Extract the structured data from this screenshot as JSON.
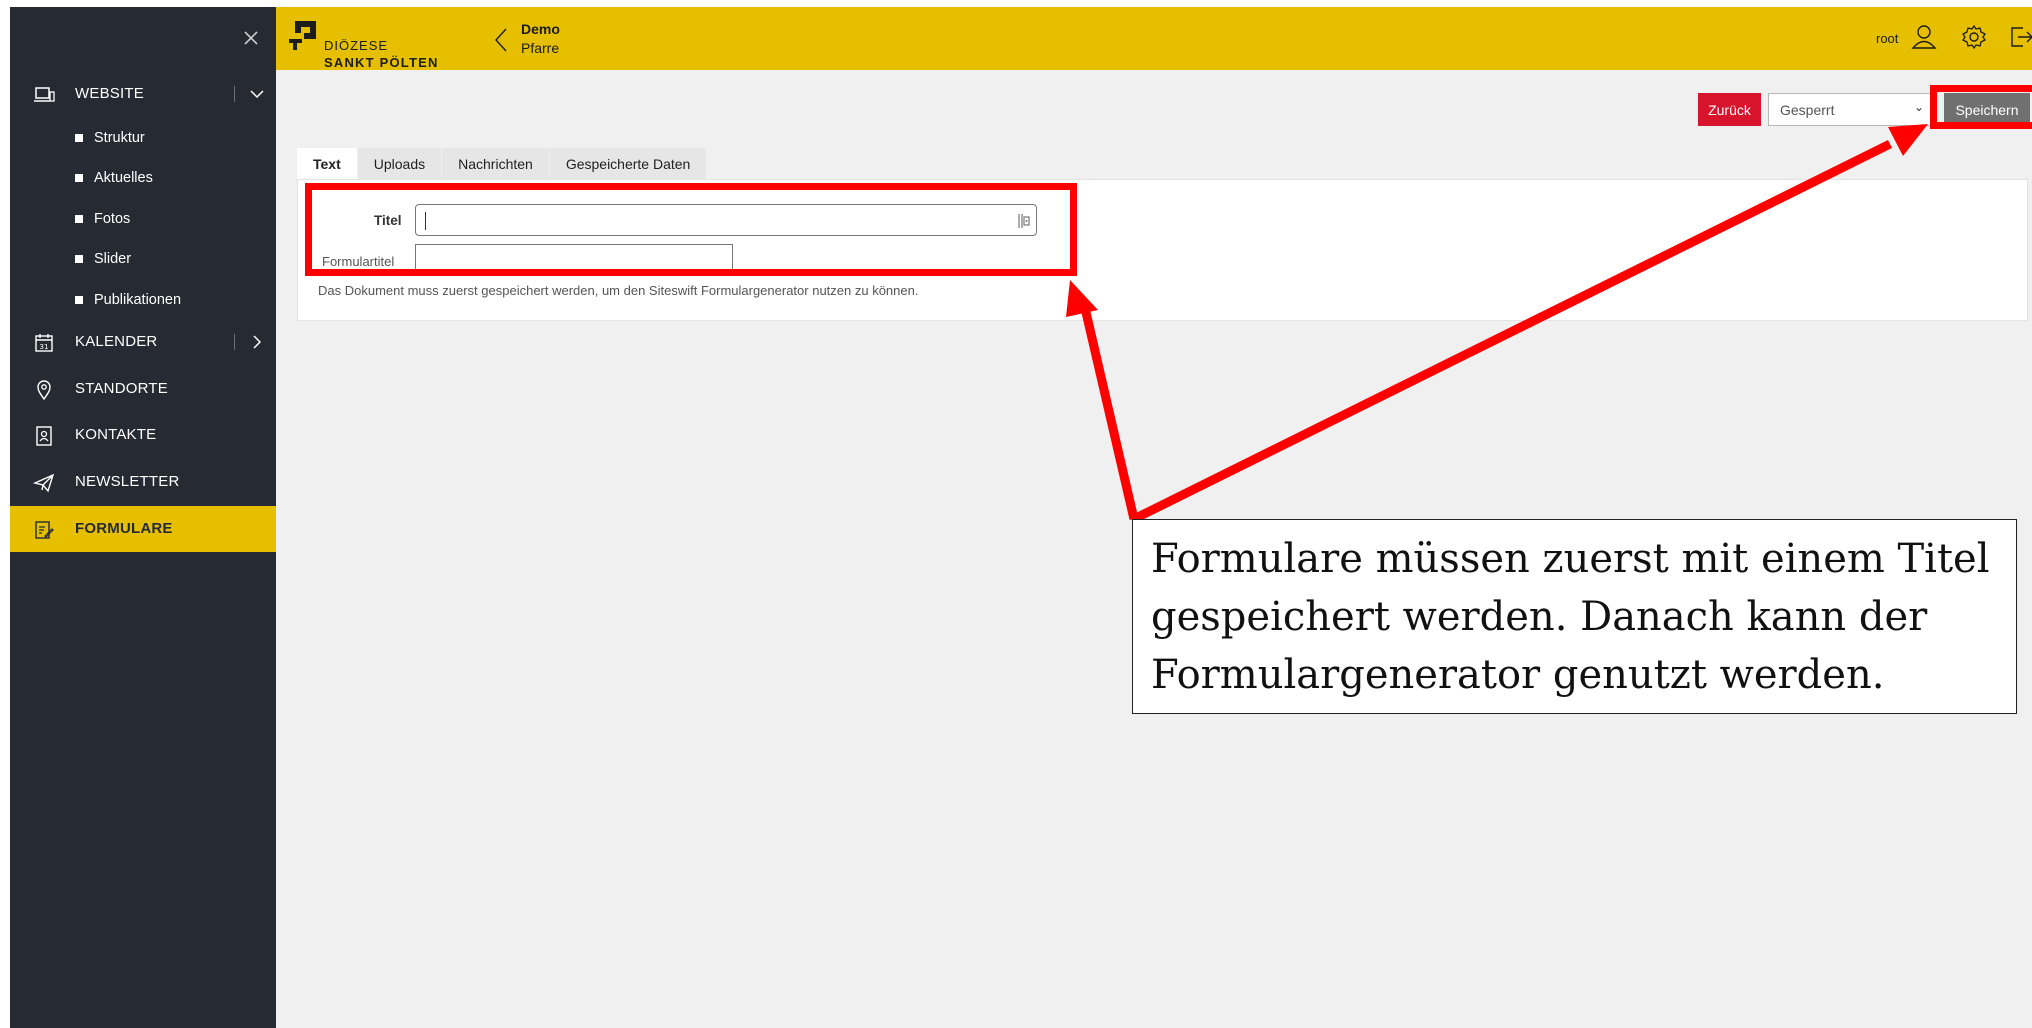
{
  "sidebar": {
    "close_label": "×",
    "items": [
      {
        "label": "WEBSITE",
        "icon": "laptop-icon"
      },
      {
        "label": "KALENDER",
        "icon": "calendar-icon"
      },
      {
        "label": "STANDORTE",
        "icon": "location-pin-icon"
      },
      {
        "label": "KONTAKTE",
        "icon": "contact-card-icon"
      },
      {
        "label": "NEWSLETTER",
        "icon": "paper-plane-icon"
      },
      {
        "label": "FORMULARE",
        "icon": "form-edit-icon"
      }
    ],
    "website_sub": [
      "Struktur",
      "Aktuelles",
      "Fotos",
      "Slider",
      "Publikationen"
    ],
    "active_item": "FORMULARE",
    "active_color": "#e6bf00"
  },
  "header": {
    "brand_line1": "DIÖZESE",
    "brand_line2": "SANKT PÖLTEN",
    "breadcrumb_title": "Demo",
    "breadcrumb_sub": "Pfarre",
    "user": "root",
    "bar_color": "#e6bf00"
  },
  "toolbar": {
    "back_label": "Zurück",
    "status_value": "Gesperrt",
    "save_label": "Speichern"
  },
  "tabs": [
    "Text",
    "Uploads",
    "Nachrichten",
    "Gespeicherte Daten"
  ],
  "active_tab": "Text",
  "form": {
    "titel_label": "Titel",
    "titel_value": "",
    "formtitel_label": "Formulartitel",
    "formtitel_value": "",
    "help_text": "Das Dokument muss zuerst gespeichert werden, um den Siteswift Formulargenerator nutzen zu können."
  },
  "annotation": {
    "callout_text": "Formulare müssen zuerst mit einem Titel gespeichert werden. Danach kann der Formulargenerator genutzt werden.",
    "highlight_color": "#ff0000"
  }
}
